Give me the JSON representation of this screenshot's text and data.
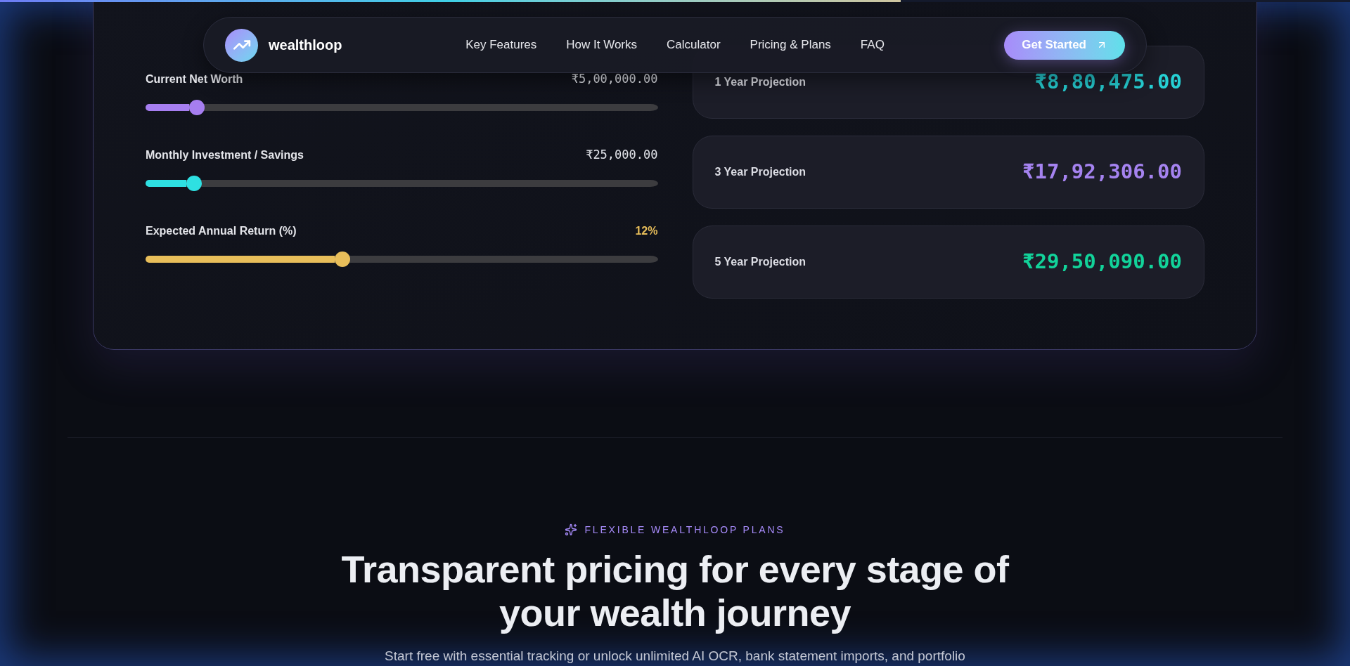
{
  "scroll_progress": {
    "level": 0.667
  },
  "nav": {
    "brand": "wealthloop",
    "links": [
      "Key Features",
      "How It Works",
      "Calculator",
      "Pricing & Plans",
      "FAQ"
    ],
    "cta": "Get Started"
  },
  "calculator": {
    "sliders": [
      {
        "label": "Current Net Worth",
        "value": "₹5,00,000.00",
        "kind": "currency",
        "level": 0.1,
        "color": "#a67ef0"
      },
      {
        "label": "Monthly Investment / Savings",
        "value": "₹25,000.00",
        "kind": "currency",
        "level": 0.095,
        "color": "#2ee0e2"
      },
      {
        "label": "Expected Annual Return (%)",
        "value": "12%",
        "kind": "percent",
        "level": 0.385,
        "color": "#e8be5a"
      }
    ],
    "projections": [
      {
        "label": "1 Year Projection",
        "value": "₹8,80,475.00",
        "color": "#26d0d4"
      },
      {
        "label": "3 Year Projection",
        "value": "₹17,92,306.00",
        "color": "#a583f0"
      },
      {
        "label": "5 Year Projection",
        "value": "₹29,50,090.00",
        "color": "#12d39a"
      }
    ]
  },
  "pricing": {
    "eyebrow": "FLEXIBLE WEALTHLOOP PLANS",
    "title": "Transparent pricing for every stage of your wealth journey",
    "subtitle": "Start free with essential tracking or unlock unlimited AI OCR, bank statement imports, and portfolio"
  }
}
